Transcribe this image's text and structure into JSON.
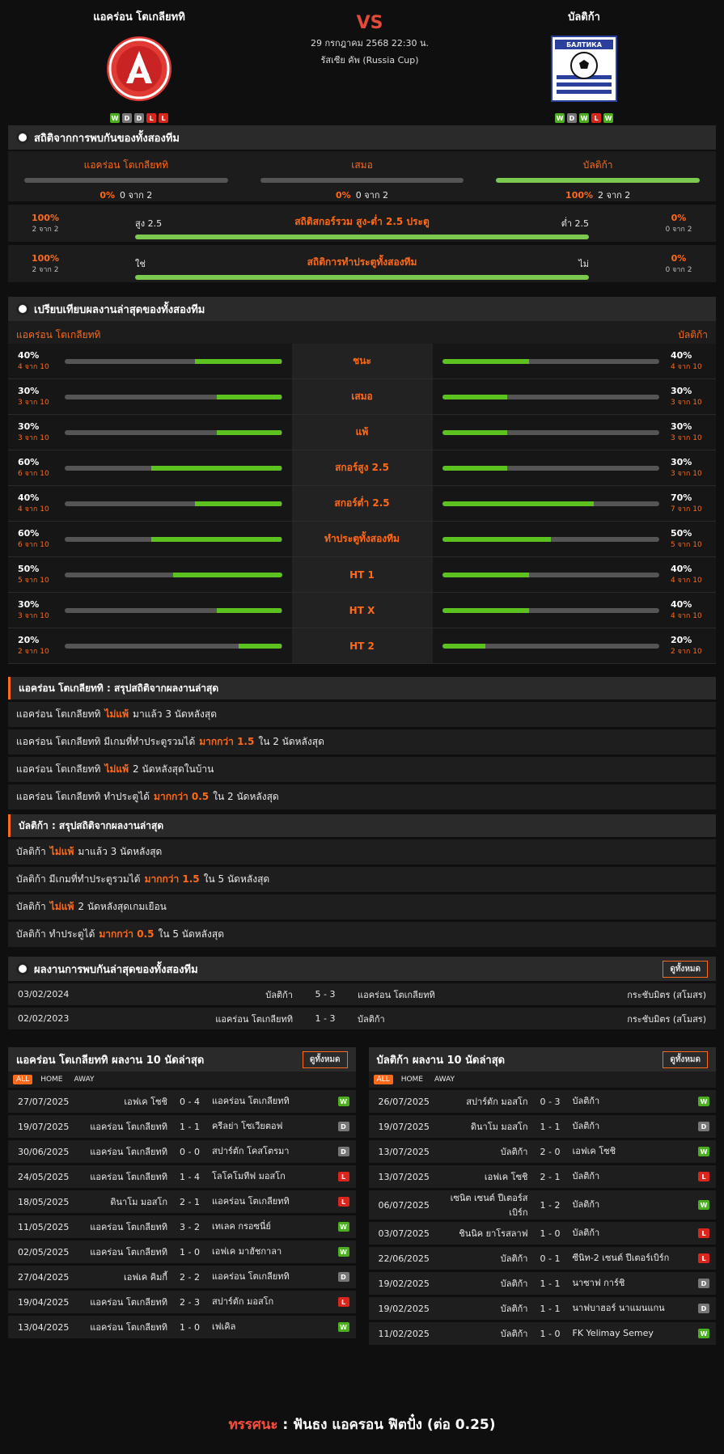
{
  "header": {
    "home_name": "แอคร่อน โตเกลียททิ",
    "away_name": "บัลติก้า",
    "vs": "VS",
    "datetime": "29 กรกฎาคม 2568 22:30 น.",
    "competition": "รัสเซีย คัพ (Russia Cup)",
    "home_form": [
      "W",
      "D",
      "D",
      "L",
      "L"
    ],
    "away_form": [
      "W",
      "D",
      "W",
      "L",
      "W"
    ],
    "away_logo_text": "БАЛТИКА"
  },
  "h2h_stats": {
    "title": "สถิติจากการพบกันของทั้งสองทีม",
    "cols": [
      {
        "label": "แอคร่อน โตเกลียททิ",
        "pct": "0%",
        "count": "0 จาก 2",
        "value": 0
      },
      {
        "label": "เสมอ",
        "pct": "0%",
        "count": "0 จาก 2",
        "value": 0
      },
      {
        "label": "บัลติก้า",
        "pct": "100%",
        "count": "2 จาก 2",
        "value": 100
      }
    ],
    "ou": {
      "title": "สถิติสกอร์รวม สูง-ต่ำ 2.5 ประตู",
      "left_label": "สูง 2.5",
      "right_label": "ต่ำ 2.5",
      "left_pct": "100%",
      "left_count": "2 จาก 2",
      "right_pct": "0%",
      "right_count": "0 จาก 2",
      "value": 100
    },
    "btts": {
      "title": "สถิติการทำประตูทั้งสองทีม",
      "left_label": "ใช่",
      "right_label": "ไม่",
      "left_pct": "100%",
      "left_count": "2 จาก 2",
      "right_pct": "0%",
      "right_count": "0 จาก 2",
      "value": 100
    }
  },
  "compare": {
    "title": "เปรียบเทียบผลงานล่าสุดของทั้งสองทีม",
    "home": "แอคร่อน โตเกลียททิ",
    "away": "บัลติก้า",
    "rows": [
      {
        "label": "ชนะ",
        "hp": "40%",
        "hc": "4 จาก 10",
        "hv": 40,
        "ap": "40%",
        "ac": "4 จาก 10",
        "av": 40
      },
      {
        "label": "เสมอ",
        "hp": "30%",
        "hc": "3 จาก 10",
        "hv": 30,
        "ap": "30%",
        "ac": "3 จาก 10",
        "av": 30
      },
      {
        "label": "แพ้",
        "hp": "30%",
        "hc": "3 จาก 10",
        "hv": 30,
        "ap": "30%",
        "ac": "3 จาก 10",
        "av": 30
      },
      {
        "label": "สกอร์สูง 2.5",
        "hp": "60%",
        "hc": "6 จาก 10",
        "hv": 60,
        "ap": "30%",
        "ac": "3 จาก 10",
        "av": 30
      },
      {
        "label": "สกอร์ต่ำ 2.5",
        "hp": "40%",
        "hc": "4 จาก 10",
        "hv": 40,
        "ap": "70%",
        "ac": "7 จาก 10",
        "av": 70
      },
      {
        "label": "ทำประตูทั้งสองทีม",
        "hp": "60%",
        "hc": "6 จาก 10",
        "hv": 60,
        "ap": "50%",
        "ac": "5 จาก 10",
        "av": 50
      },
      {
        "label": "HT 1",
        "hp": "50%",
        "hc": "5 จาก 10",
        "hv": 50,
        "ap": "40%",
        "ac": "4 จาก 10",
        "av": 40
      },
      {
        "label": "HT X",
        "hp": "30%",
        "hc": "3 จาก 10",
        "hv": 30,
        "ap": "40%",
        "ac": "4 จาก 10",
        "av": 40
      },
      {
        "label": "HT 2",
        "hp": "20%",
        "hc": "2 จาก 10",
        "hv": 20,
        "ap": "20%",
        "ac": "2 จาก 10",
        "av": 20
      }
    ]
  },
  "home_summary": {
    "title": "แอคร่อน โตเกลียททิ : สรุปสถิติจากผลงานล่าสุด",
    "rows": [
      {
        "a": "แอคร่อน โตเกลียททิ",
        "hl": "ไม่แพ้",
        "b": "มาแล้ว 3 นัดหลังสุด"
      },
      {
        "a": "แอคร่อน โตเกลียททิ  มีเกมที่ทำประตูรวมได้",
        "hl": "มากกว่า 1.5",
        "b": "ใน 2 นัดหลังสุด"
      },
      {
        "a": "แอคร่อน โตเกลียททิ",
        "hl": "ไม่แพ้",
        "b": "2  นัดหลังสุดในบ้าน"
      },
      {
        "a": "แอคร่อน โตเกลียททิ  ทำประตูได้",
        "hl": "มากกว่า  0.5",
        "b": "ใน 2 นัดหลังสุด"
      }
    ]
  },
  "away_summary": {
    "title": "บัลติก้า : สรุปสถิติจากผลงานล่าสุด",
    "rows": [
      {
        "a": "บัลติก้า",
        "hl": "ไม่แพ้",
        "b": "มาแล้ว 3 นัดหลังสุด"
      },
      {
        "a": "บัลติก้า  มีเกมที่ทำประตูรวมได้",
        "hl": "มากกว่า 1.5",
        "b": "ใน 5 นัดหลังสุด"
      },
      {
        "a": "บัลติก้า",
        "hl": "ไม่แพ้",
        "b": "2  นัดหลังสุดเกมเยือน"
      },
      {
        "a": "บัลติก้า  ทำประตูได้",
        "hl": "มากกว่า  0.5",
        "b": "ใน 5 นัดหลังสุด"
      }
    ]
  },
  "h2h_matches": {
    "title": "ผลงานการพบกันล่าสุดของทั้งสองทีม",
    "view_all": "ดูทั้งหมด",
    "rows": [
      {
        "date": "03/02/2024",
        "home": "บัลติก้า",
        "score": "5 - 3",
        "away": "แอคร่อน โตเกลียททิ",
        "comp": "กระชับมิตร (สโมสร)"
      },
      {
        "date": "02/02/2023",
        "home": "แอคร่อน โตเกลียททิ",
        "score": "1 - 3",
        "away": "บัลติก้า",
        "comp": "กระชับมิตร (สโมสร)"
      }
    ]
  },
  "home_last10": {
    "title": "แอคร่อน โตเกลียททิ ผลงาน 10 นัดล่าสุด",
    "view_all": "ดูทั้งหมด",
    "filters": [
      "ALL",
      "HOME",
      "AWAY"
    ],
    "rows": [
      {
        "date": "27/07/2025",
        "home": "เอฟเค โซชิ",
        "score": "0 - 4",
        "away": "แอคร่อน โตเกลียททิ",
        "r": "W"
      },
      {
        "date": "19/07/2025",
        "home": "แอคร่อน โตเกลียททิ",
        "score": "1 - 1",
        "away": "ครีลย่า โซเวียตอฟ",
        "r": "D"
      },
      {
        "date": "30/06/2025",
        "home": "แอคร่อน โตเกลียททิ",
        "score": "0 - 0",
        "away": "สปาร์ตัก โคสโตรมา",
        "r": "D"
      },
      {
        "date": "24/05/2025",
        "home": "แอคร่อน โตเกลียททิ",
        "score": "1 - 4",
        "away": "โลโคโมทีฟ มอสโก",
        "r": "L"
      },
      {
        "date": "18/05/2025",
        "home": "ดินาโม มอสโก",
        "score": "2 - 1",
        "away": "แอคร่อน โตเกลียททิ",
        "r": "L"
      },
      {
        "date": "11/05/2025",
        "home": "แอคร่อน โตเกลียททิ",
        "score": "3 - 2",
        "away": "เทเลค กรอซนี่ย์",
        "r": "W"
      },
      {
        "date": "02/05/2025",
        "home": "แอคร่อน โตเกลียททิ",
        "score": "1 - 0",
        "away": "เอฟเค มาฮัชกาลา",
        "r": "W"
      },
      {
        "date": "27/04/2025",
        "home": "เอฟเค คิมกี้",
        "score": "2 - 2",
        "away": "แอคร่อน โตเกลียททิ",
        "r": "D"
      },
      {
        "date": "19/04/2025",
        "home": "แอคร่อน โตเกลียททิ",
        "score": "2 - 3",
        "away": "สปาร์ตัก มอสโก",
        "r": "L"
      },
      {
        "date": "13/04/2025",
        "home": "แอคร่อน โตเกลียททิ",
        "score": "1 - 0",
        "away": "เฟเคิล",
        "r": "W"
      }
    ]
  },
  "away_last10": {
    "title": "บัลติก้า ผลงาน 10 นัดล่าสุด",
    "view_all": "ดูทั้งหมด",
    "filters": [
      "ALL",
      "HOME",
      "AWAY"
    ],
    "rows": [
      {
        "date": "26/07/2025",
        "home": "สปาร์ตัก มอสโก",
        "score": "0 - 3",
        "away": "บัลติก้า",
        "r": "W"
      },
      {
        "date": "19/07/2025",
        "home": "ดินาโม มอสโก",
        "score": "1 - 1",
        "away": "บัลติก้า",
        "r": "D"
      },
      {
        "date": "13/07/2025",
        "home": "บัลติก้า",
        "score": "2 - 0",
        "away": "เอฟเค โซชิ",
        "r": "W"
      },
      {
        "date": "13/07/2025",
        "home": "เอฟเค โซชิ",
        "score": "2 - 1",
        "away": "บัลติก้า",
        "r": "L"
      },
      {
        "date": "06/07/2025",
        "home": "เซนิต เซนต์ ปีเตอร์สเบิร์ก",
        "score": "1 - 2",
        "away": "บัลติก้า",
        "r": "W"
      },
      {
        "date": "03/07/2025",
        "home": "ชินนิค ยาโรสลาฟ",
        "score": "1 - 0",
        "away": "บัลติก้า",
        "r": "L"
      },
      {
        "date": "22/06/2025",
        "home": "บัลติก้า",
        "score": "0 - 1",
        "away": "ซีนิท-2 เซนต์ ปีเตอร์เบิร์ก",
        "r": "L"
      },
      {
        "date": "19/02/2025",
        "home": "บัลติก้า",
        "score": "1 - 1",
        "away": "นาซาฟ การ์ชิ",
        "r": "D"
      },
      {
        "date": "19/02/2025",
        "home": "บัลติก้า",
        "score": "1 - 1",
        "away": "นาฟบาฮอร์ นาแมนแกน",
        "r": "D"
      },
      {
        "date": "11/02/2025",
        "home": "บัลติก้า",
        "score": "1 - 0",
        "away": "FK Yelimay Semey",
        "r": "W"
      }
    ]
  },
  "footer": {
    "prefix": "ทรรศนะ",
    "sep": " :  ",
    "text": "ฟันธง แอครอน ฟิตปั๋ง (ต่อ 0.25)"
  },
  "colors": {
    "accent": "#ff6a1a",
    "win": "#4caf1f",
    "draw": "#777777",
    "loss": "#d9251c"
  }
}
